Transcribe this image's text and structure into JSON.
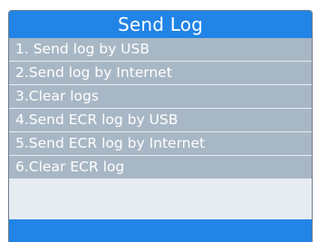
{
  "header": {
    "title": "Send Log"
  },
  "menu": {
    "items": [
      {
        "label": "1. Send log by USB"
      },
      {
        "label": "2.Send log by Internet"
      },
      {
        "label": "3.Clear logs"
      },
      {
        "label": "4.Send ECR log by USB"
      },
      {
        "label": "5.Send ECR log by Internet"
      },
      {
        "label": "6.Clear ECR log"
      }
    ]
  },
  "colors": {
    "title_bar": "#2284e6",
    "item_background": "#a8b7c5",
    "item_text": "#ffffff",
    "separator": "#e7ecf1"
  }
}
